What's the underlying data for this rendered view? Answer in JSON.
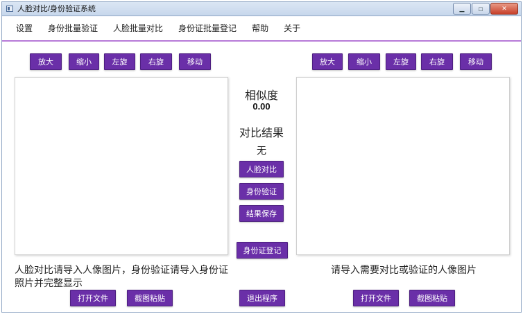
{
  "window": {
    "title": "人脸对比/身份验证系统",
    "controls": {
      "minimize": "▁",
      "maximize": "□",
      "close": "✕"
    }
  },
  "menu": [
    "设置",
    "身份批量验证",
    "人脸批量对比",
    "身份证批量登记",
    "帮助",
    "关于"
  ],
  "left_toolbar": [
    "放大",
    "缩小",
    "左旋",
    "右旋",
    "移动"
  ],
  "right_toolbar": [
    "放大",
    "缩小",
    "左旋",
    "右旋",
    "移动"
  ],
  "center": {
    "similarity_label": "相似度",
    "similarity_value": "0.00",
    "result_label": "对比结果",
    "result_value": "无",
    "compare_button": "人脸对比",
    "verify_button": "身份验证",
    "save_button": "结果保存",
    "register_button": "身份证登记",
    "exit_button": "退出程序"
  },
  "left": {
    "hint": "人脸对比请导入人像图片，身份验证请导入身份证照片并完整显示",
    "open_button": "打开文件",
    "paste_button": "截图粘贴"
  },
  "right": {
    "hint": "请导入需要对比或验证的人像图片",
    "open_button": "打开文件",
    "paste_button": "截图粘贴"
  },
  "colors": {
    "accent": "#6a2fa8",
    "menu_rule": "#b77ad8"
  }
}
